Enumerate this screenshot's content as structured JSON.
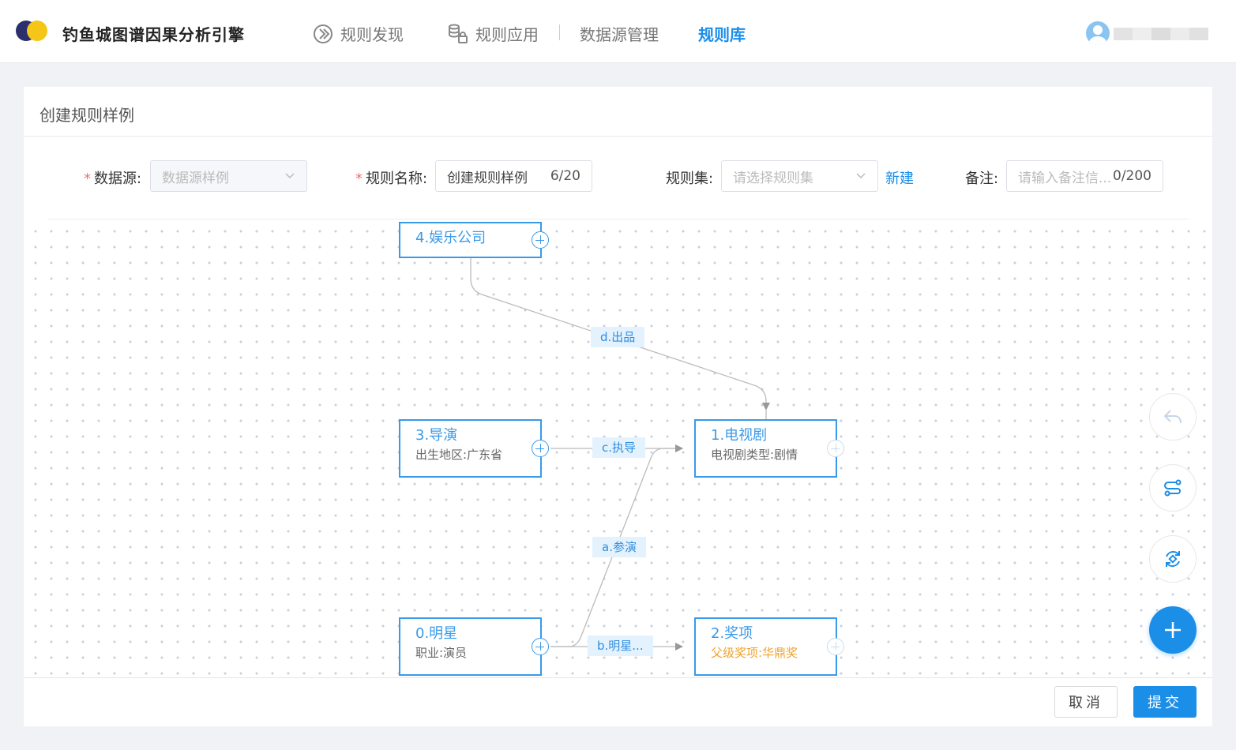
{
  "app": {
    "title": "钓鱼城图谱因果分析引擎"
  },
  "nav": [
    {
      "label": "规则发现",
      "icon": "rule-discover-icon",
      "active": false
    },
    {
      "label": "规则应用",
      "icon": "rule-apply-icon",
      "active": false
    },
    {
      "label": "数据源管理",
      "active": false
    },
    {
      "label": "规则库",
      "active": true
    }
  ],
  "user": {
    "avatar_icon": "user-avatar-icon",
    "name": ""
  },
  "page": {
    "title": "创建规则样例"
  },
  "form": {
    "datasource": {
      "label": "数据源:",
      "value": "数据源样例",
      "disabled": true
    },
    "rule_name": {
      "label": "规则名称:",
      "value": "创建规则样例",
      "count": "6/20"
    },
    "rule_set": {
      "label": "规则集:",
      "placeholder": "请选择规则集",
      "new_label": "新建"
    },
    "note": {
      "label": "备注:",
      "placeholder": "请输入备注信...",
      "count": "0/200"
    }
  },
  "graph": {
    "nodes": [
      {
        "title": "4.娱乐公司",
        "subtitle": ""
      },
      {
        "title": "3.导演",
        "subtitle": "出生地区:广东省"
      },
      {
        "title": "1.电视剧",
        "subtitle": "电视剧类型:剧情"
      },
      {
        "title": "0.明星",
        "subtitle": "职业:演员"
      },
      {
        "title": "2.奖项",
        "subtitle": "父级奖项:华鼎奖"
      }
    ],
    "edges": [
      {
        "label": "d.出品"
      },
      {
        "label": "c.执导"
      },
      {
        "label": "a.参演"
      },
      {
        "label": "b.明星..."
      }
    ]
  },
  "tools": [
    {
      "icon": "undo-icon"
    },
    {
      "icon": "route-icon"
    },
    {
      "icon": "refresh-layout-icon"
    },
    {
      "icon": "add-icon"
    }
  ],
  "footer": {
    "cancel_label": "取消",
    "submit_label": "提交"
  },
  "colors": {
    "accent": "#1b8ee8",
    "node_border": "#3a9aea",
    "required": "#f56c6c",
    "warning": "#f0a32a"
  }
}
